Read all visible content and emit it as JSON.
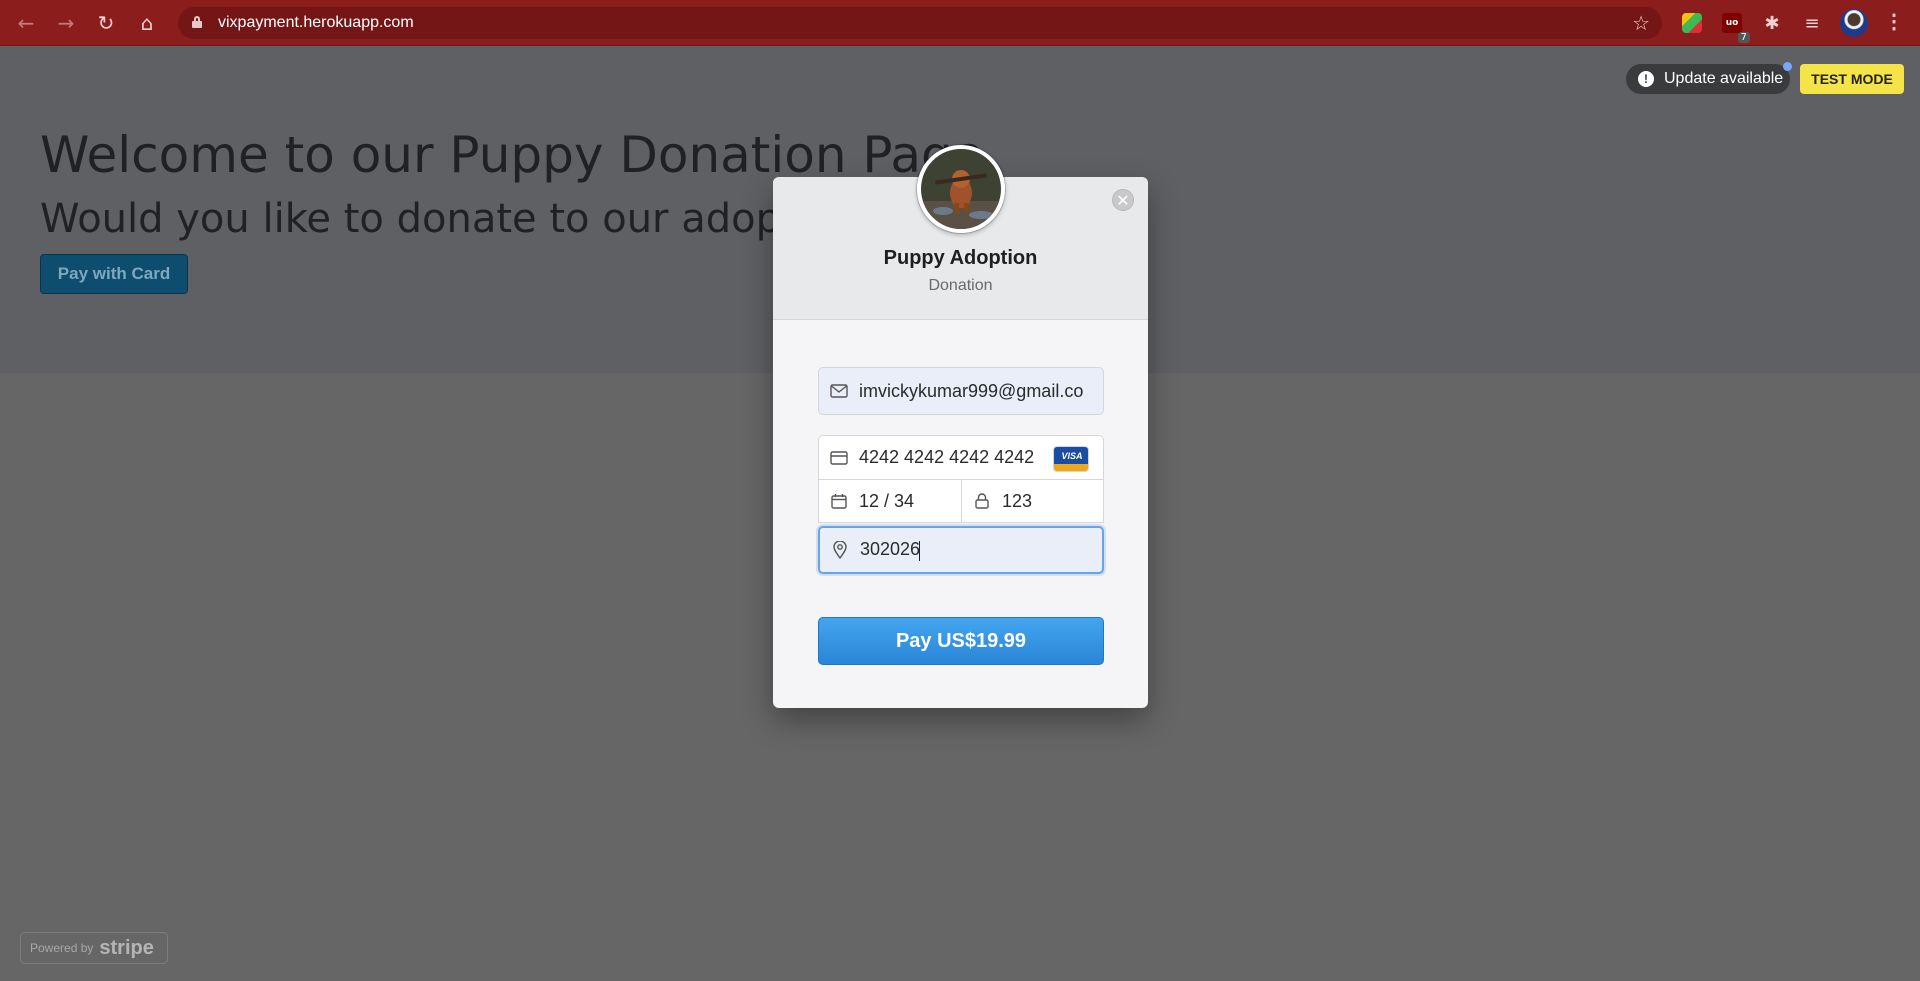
{
  "browser": {
    "url": "vixpayment.herokuapp.com",
    "extensions_badge": "7"
  },
  "page": {
    "heading": "Welcome to our Puppy Donation Page",
    "subheading": "Would you like to donate to our adoptio",
    "pay_with_card_label": "Pay with Card",
    "update_label": "Update available",
    "test_mode_label": "TEST MODE",
    "powered_prefix": "Powered by",
    "powered_brand": "stripe"
  },
  "checkout": {
    "title": "Puppy Adoption",
    "subtitle": "Donation",
    "email": "imvickykumar999@gmail.co",
    "card_number": "4242 4242 4242 4242",
    "card_brand": "VISA",
    "expiry": "12 / 34",
    "cvc": "123",
    "zip": "302026",
    "pay_label": "Pay US$19.99"
  },
  "colors": {
    "browser_frame": "#8c1d1d",
    "pay_button": "#2a86d8",
    "test_mode": "#f5e447"
  }
}
